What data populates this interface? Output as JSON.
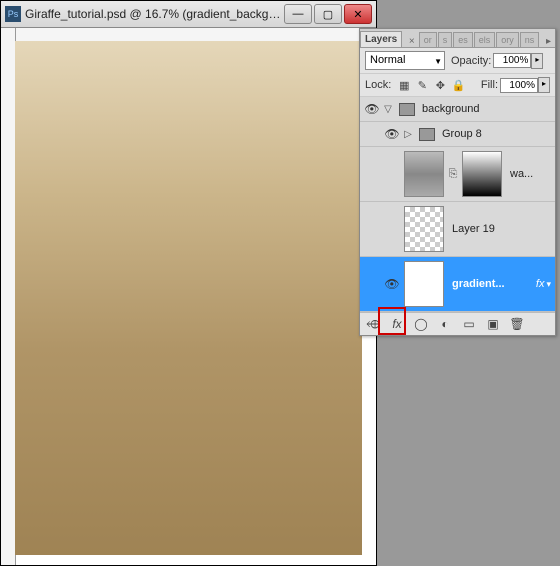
{
  "window": {
    "title": "Giraffe_tutorial.psd @ 16.7% (gradient_backgro..."
  },
  "panel": {
    "tabs": {
      "layers": "Layers",
      "t2": "or",
      "t3": "s",
      "t4": "es",
      "t5": "els",
      "t6": "ory",
      "t7": "ns"
    },
    "blend_mode": "Normal",
    "opacity_label": "Opacity:",
    "opacity_value": "100%",
    "lock_label": "Lock:",
    "fill_label": "Fill:",
    "fill_value": "100%"
  },
  "layers": {
    "root": "background",
    "group": "Group 8",
    "wa": "wa...",
    "layer19": "Layer 19",
    "gradient": "gradient...",
    "fx": "fx"
  },
  "bottom_icons": {
    "link": "⬲",
    "fx": "fx",
    "mask": "◯",
    "adjust": "◐",
    "folder": "▭",
    "new": "▣",
    "trash": "🗑"
  }
}
